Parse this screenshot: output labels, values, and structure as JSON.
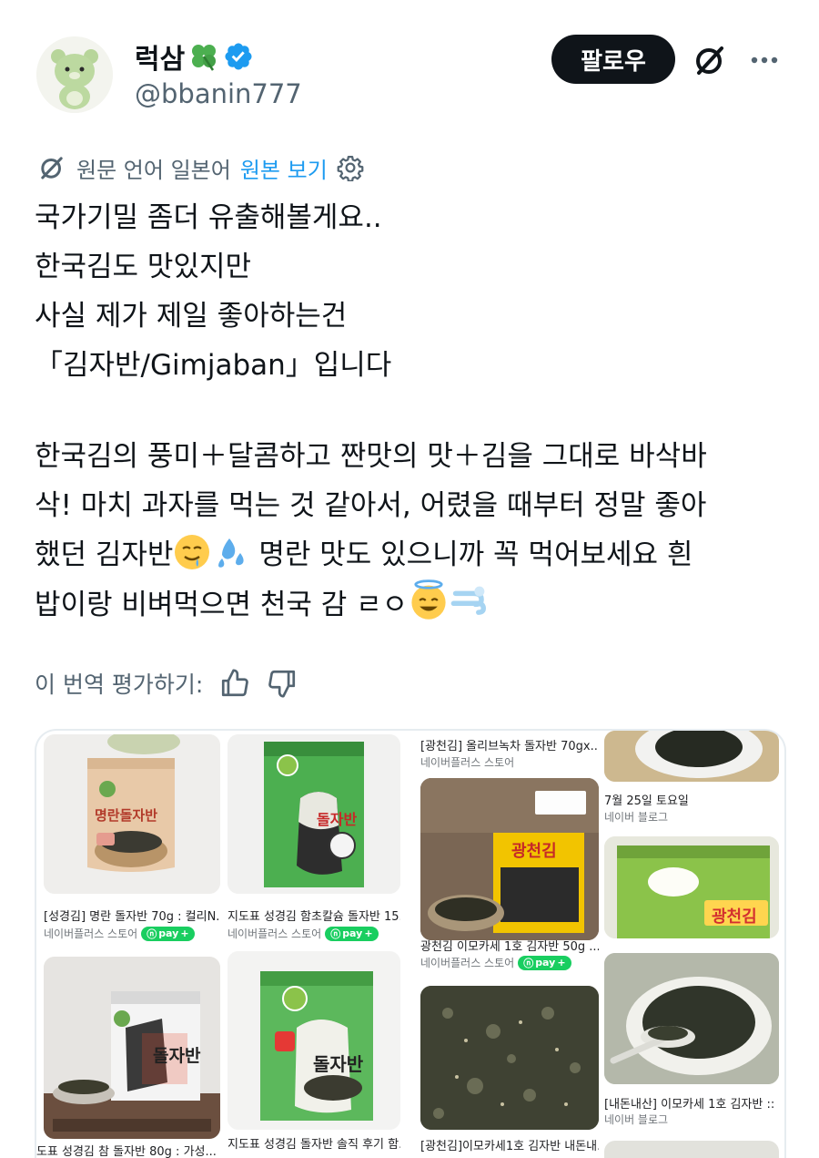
{
  "user": {
    "display_name": "럭삼",
    "name_emoji": "☘️",
    "handle": "@bbanin777",
    "verified": true
  },
  "actions": {
    "follow_label": "팔로우",
    "grok_icon": "grok-icon",
    "more_icon": "more-icon"
  },
  "translation": {
    "source_text": "원문 언어 일본어",
    "show_original_label": "원본 보기",
    "settings_icon": "gear-icon"
  },
  "tweet": {
    "lines": [
      "국가기밀 좀더 유출해볼게요..",
      "한국김도 맛있지만",
      "사실 제가 제일 좋아하는건",
      "「김자반/Gimjaban」입니다"
    ],
    "para2_line1": "한국김의 풍미＋달콤하고 짠맛의 맛＋김을 그대로 바삭바",
    "para2_line2": "삭! 마치 과자를 먹는 것 같아서, 어렸을 때부터 정말 좋아",
    "para2_line3a": "했던 김자반",
    "para2_line3b": " 명란 맛도 있으니까 꼭 먹어보세요 흰",
    "para2_line4a": "밥이랑 비벼먹으면 천국 감 ㄹㅇ"
  },
  "rate": {
    "label": "이 번역 평가하기:",
    "like_icon": "thumbs-up-icon",
    "dislike_icon": "thumbs-down-icon"
  },
  "media": {
    "col1": [
      {
        "caption": "[성경김] 명란 돌자반 70g : 컬리N...",
        "source": "네이버플러스 스토어",
        "npay": true,
        "pkg_text": "명란돌자반"
      },
      {
        "caption": "지도표 성경김 참 돌자반 80g : 가성...",
        "pkg_text": "돌자반"
      }
    ],
    "col2": [
      {
        "caption": "지도표 성경김 함초칼슘 돌자반 15...",
        "source": "네이버플러스 스토어",
        "npay": true,
        "pkg_text": "돌자반"
      },
      {
        "caption": "지도표 성경김 돌자반 솔직 후기 함...",
        "pkg_text": "돌자반"
      }
    ],
    "col3": [
      {
        "caption": "[광천김] 올리브녹차 돌자반 70gx...",
        "source": "네이버플러스 스토어"
      },
      {
        "caption": "광천김 이모카세 1호 김자반 50g ...",
        "source": "네이버플러스 스토어",
        "npay": true,
        "pkg_text": "광천김"
      },
      {
        "caption": "[광천김]이모카세1호 김자반 내돈내..."
      }
    ],
    "col4": [
      {
        "caption": "7월 25일 토요일",
        "source": "네이버 블로그"
      },
      {
        "caption": "[내돈내산] 이모카세 1호 김자반 :: ...",
        "source": "네이버 블로그",
        "pkg_text": "광천김"
      }
    ],
    "npay_label": "pay"
  },
  "colors": {
    "accent": "#1d9bf0",
    "text": "#0f1419",
    "muted": "#536471",
    "npay": "#19ce60"
  }
}
